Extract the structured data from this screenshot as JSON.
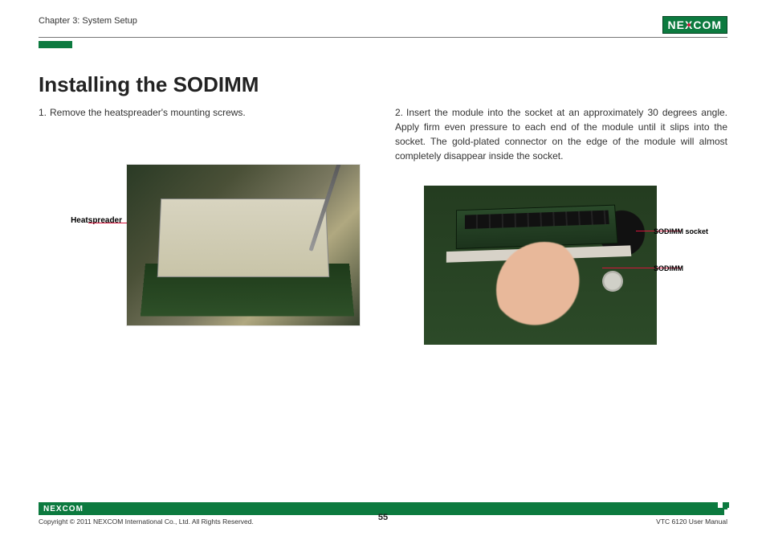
{
  "header": {
    "chapter": "Chapter 3: System Setup",
    "logo_text_pre": "NE",
    "logo_text_x": "X",
    "logo_text_post": "COM"
  },
  "title": "Installing the SODIMM",
  "steps": {
    "s1_num": "1.",
    "s1_text": "Remove the heatspreader's mounting screws.",
    "s2_num": "2.",
    "s2_text": "Insert the module into the socket at an approximately 30 degrees angle. Apply firm even pressure to each end of the module until it slips into the socket. The gold-plated connector on the edge of the module will almost completely disappear inside the socket."
  },
  "callouts": {
    "heatspreader": "Heatspreader",
    "sodimm_socket": "SODIMM socket",
    "sodimm": "SODIMM"
  },
  "footer": {
    "logo_pre": "NE",
    "logo_x": "X",
    "logo_post": "COM",
    "copyright": "Copyright © 2011 NEXCOM International Co., Ltd. All Rights Reserved.",
    "page": "55",
    "doc": "VTC 6120 User Manual"
  }
}
